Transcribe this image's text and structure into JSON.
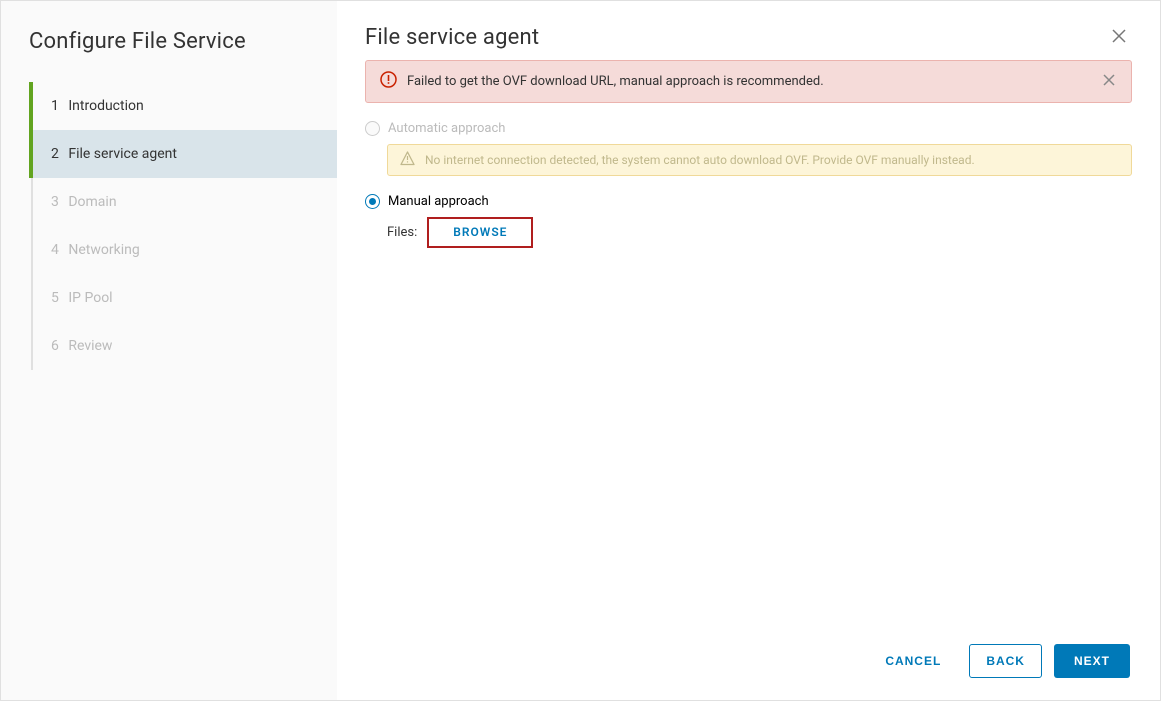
{
  "sidebar": {
    "title": "Configure File Service",
    "steps": [
      {
        "num": "1",
        "label": "Introduction"
      },
      {
        "num": "2",
        "label": "File service agent"
      },
      {
        "num": "3",
        "label": "Domain"
      },
      {
        "num": "4",
        "label": "Networking"
      },
      {
        "num": "5",
        "label": "IP Pool"
      },
      {
        "num": "6",
        "label": "Review"
      }
    ]
  },
  "main": {
    "title": "File service agent",
    "error_msg": "Failed to get the OVF download URL, manual approach is recommended.",
    "automatic": {
      "label": "Automatic approach",
      "warning": "No internet connection detected, the system cannot auto download OVF. Provide OVF manually instead."
    },
    "manual": {
      "label": "Manual approach",
      "files_label": "Files:",
      "browse_label": "BROWSE"
    }
  },
  "footer": {
    "cancel": "CANCEL",
    "back": "BACK",
    "next": "NEXT"
  }
}
